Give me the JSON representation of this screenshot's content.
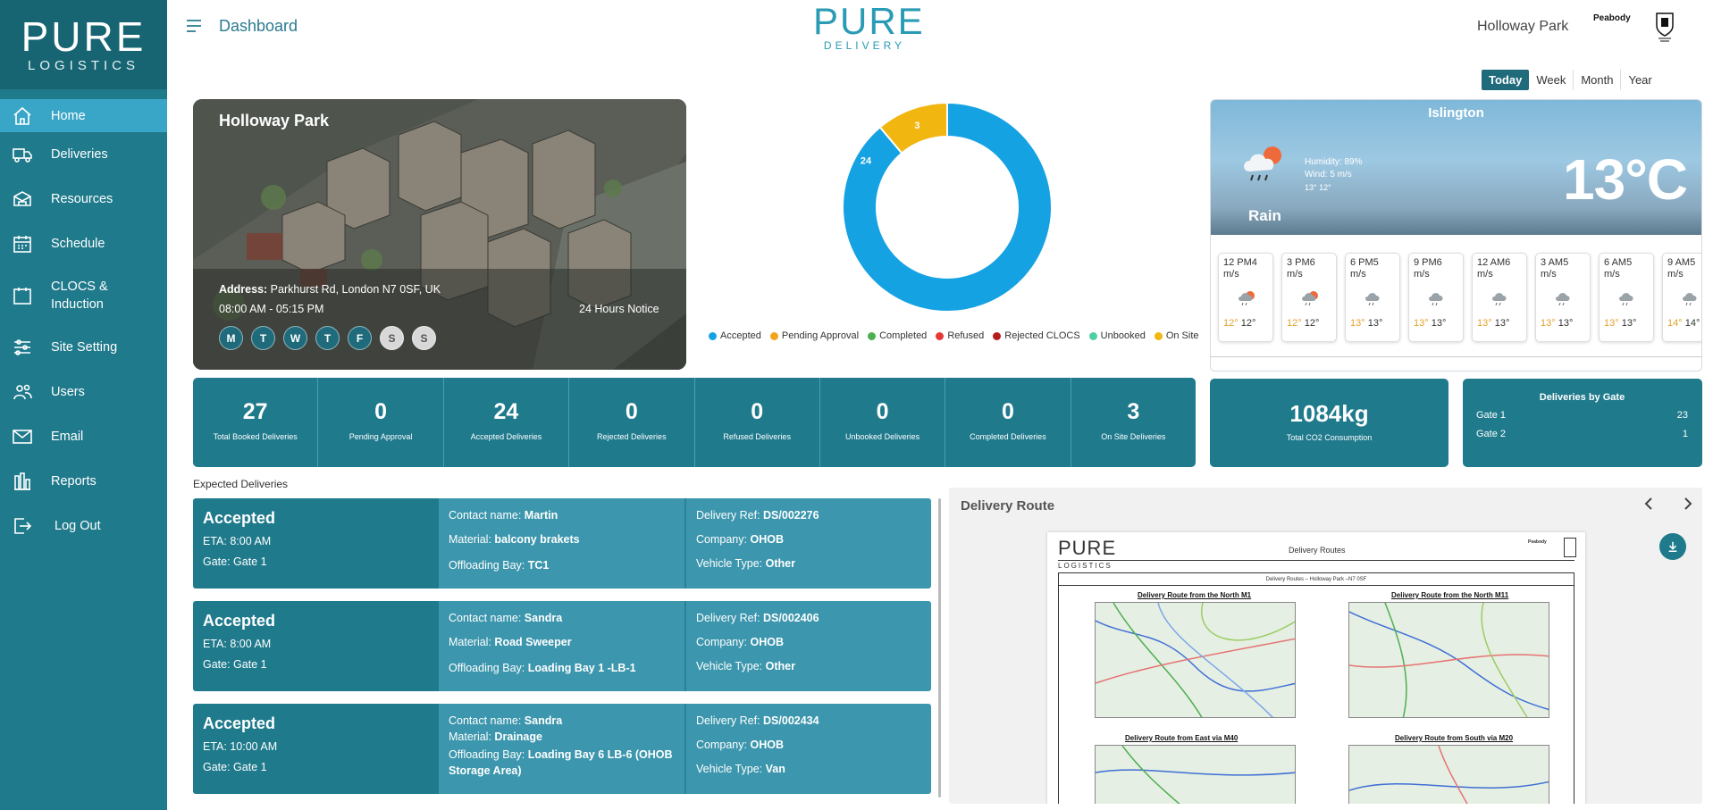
{
  "sidebar": {
    "logo_main": "PURE",
    "logo_sub": "LOGISTICS",
    "items": [
      {
        "label": "Home",
        "icon": "home-icon"
      },
      {
        "label": "Deliveries",
        "icon": "truck-icon"
      },
      {
        "label": "Resources",
        "icon": "resources-icon"
      },
      {
        "label": "Schedule",
        "icon": "calendar-icon"
      },
      {
        "label": "CLOCS & Induction",
        "icon": "calendar-icon"
      },
      {
        "label": "Site Setting",
        "icon": "sliders-icon"
      },
      {
        "label": "Users",
        "icon": "users-icon"
      },
      {
        "label": "Email",
        "icon": "mail-icon"
      },
      {
        "label": "Reports",
        "icon": "reports-icon"
      },
      {
        "label": "Log Out",
        "icon": "logout-icon"
      }
    ]
  },
  "header": {
    "title": "Dashboard",
    "brand_main": "PURE",
    "brand_sub": "DELIVERY",
    "site_name": "Holloway Park",
    "peabody": "Peabody"
  },
  "period": {
    "options": [
      "Today",
      "Week",
      "Month",
      "Year"
    ],
    "selected": "Today"
  },
  "site": {
    "name": "Holloway Park",
    "address_label": "Address:",
    "address": "Parkhurst Rd, London N7 0SF, UK",
    "hours": "08:00 AM - 05:15 PM",
    "notice": "24 Hours Notice",
    "days": [
      "M",
      "T",
      "W",
      "T",
      "F",
      "S",
      "S"
    ]
  },
  "chart_data": {
    "type": "pie",
    "categories": [
      "Accepted",
      "Pending Approval",
      "Completed",
      "Refused",
      "Rejected CLOCS",
      "Unbooked",
      "On Site"
    ],
    "values": [
      24,
      0,
      0,
      0,
      0,
      0,
      3
    ],
    "colors": [
      "#15a2e3",
      "#f3a41d",
      "#4caf50",
      "#e53935",
      "#b71c1c",
      "#4dd0a8",
      "#f1b60f"
    ],
    "donut": true,
    "legend": "bottom"
  },
  "weather": {
    "city": "Islington",
    "humidity": "Humidity: 89%",
    "wind": "Wind: 5 m/s",
    "range": "13° 12°",
    "condition": "Rain",
    "temp": "13°C",
    "hourly": [
      {
        "label": "12 PM4 m/s",
        "hi": "12°",
        "lo": "12°"
      },
      {
        "label": "3 PM6 m/s",
        "hi": "12°",
        "lo": "12°"
      },
      {
        "label": "6 PM5 m/s",
        "hi": "13°",
        "lo": "13°"
      },
      {
        "label": "9 PM6 m/s",
        "hi": "13°",
        "lo": "13°"
      },
      {
        "label": "12 AM6 m/s",
        "hi": "13°",
        "lo": "13°"
      },
      {
        "label": "3 AM5 m/s",
        "hi": "13°",
        "lo": "13°"
      },
      {
        "label": "6 AM5 m/s",
        "hi": "13°",
        "lo": "13°"
      },
      {
        "label": "9 AM5 m/s",
        "hi": "14°",
        "lo": "14°"
      }
    ]
  },
  "stats": [
    {
      "value": "27",
      "label": "Total Booked Deliveries"
    },
    {
      "value": "0",
      "label": "Pending Approval"
    },
    {
      "value": "24",
      "label": "Accepted Deliveries"
    },
    {
      "value": "0",
      "label": "Rejected Deliveries"
    },
    {
      "value": "0",
      "label": "Refused Deliveries"
    },
    {
      "value": "0",
      "label": "Unbooked Deliveries"
    },
    {
      "value": "0",
      "label": "Completed Deliveries"
    },
    {
      "value": "3",
      "label": "On Site Deliveries"
    }
  ],
  "co2": {
    "value": "1084kg",
    "label": "Total CO2 Consumption"
  },
  "gates": {
    "title": "Deliveries by Gate",
    "rows": [
      {
        "name": "Gate 1",
        "count": "23"
      },
      {
        "name": "Gate 2",
        "count": "1"
      }
    ]
  },
  "expected": {
    "title": "Expected Deliveries",
    "labels": {
      "contact": "Contact name:",
      "material": "Material:",
      "bay": "Offloading Bay:",
      "ref": "Delivery Ref:",
      "company": "Company:",
      "vehicle": "Vehicle Type:"
    },
    "items": [
      {
        "status": "Accepted",
        "eta": "ETA: 8:00 AM",
        "gate": "Gate: Gate 1",
        "contact": "Martin",
        "material": "balcony brakets",
        "bay": "TC1",
        "ref": "DS/002276",
        "company": "OHOB",
        "vehicle": "Other"
      },
      {
        "status": "Accepted",
        "eta": "ETA: 8:00 AM",
        "gate": "Gate: Gate 1",
        "contact": "Sandra",
        "material": "Road Sweeper",
        "bay": "Loading Bay 1 -LB-1",
        "ref": "DS/002406",
        "company": "OHOB",
        "vehicle": "Other"
      },
      {
        "status": "Accepted",
        "eta": "ETA: 10:00 AM",
        "gate": "Gate: Gate 1",
        "contact": "Sandra",
        "material": "Drainage",
        "bay": "Loading Bay 6 LB-6 (OHOB Storage Area)",
        "ref": "DS/002434",
        "company": "OHOB",
        "vehicle": "Van"
      }
    ]
  },
  "route": {
    "title": "Delivery Route",
    "doc_logo_main": "PURE",
    "doc_logo_sub": "LOGISTICS",
    "doc_heading": "Delivery Routes",
    "doc_peabody": "Peabody",
    "doc_bar": "Delivery Routes – Holloway Park –N7 0SF",
    "maps": [
      "Delivery Route from the North M1",
      "Delivery Route from the North M11",
      "Delivery Route from East via M40",
      "Delivery Route from South via M20"
    ]
  }
}
